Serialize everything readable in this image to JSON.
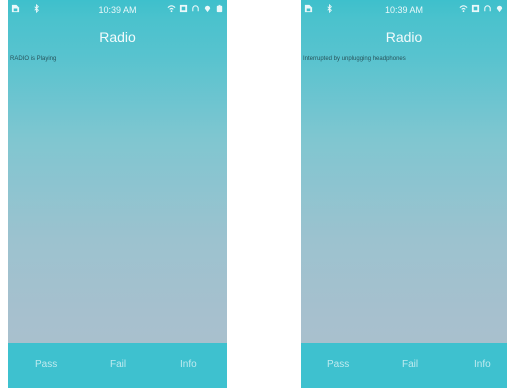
{
  "screens": [
    {
      "status_time": "10:39 AM",
      "title": "Radio",
      "status_text": "RADIO is Playing",
      "buttons": {
        "pass": "Pass",
        "fail": "Fail",
        "info": "Info"
      }
    },
    {
      "status_time": "10:39 AM",
      "title": "Radio",
      "status_text": "Interrupted by unplugging headphones",
      "buttons": {
        "pass": "Pass",
        "fail": "Fail",
        "info": "Info"
      }
    }
  ],
  "colors": {
    "accent": "#3ec1cf",
    "button_text": "#bfeaef"
  },
  "icons": [
    "sim-card-icon",
    "bluetooth-icon",
    "wifi-icon",
    "signal-icon",
    "headphones-icon",
    "location-icon",
    "battery-icon"
  ]
}
